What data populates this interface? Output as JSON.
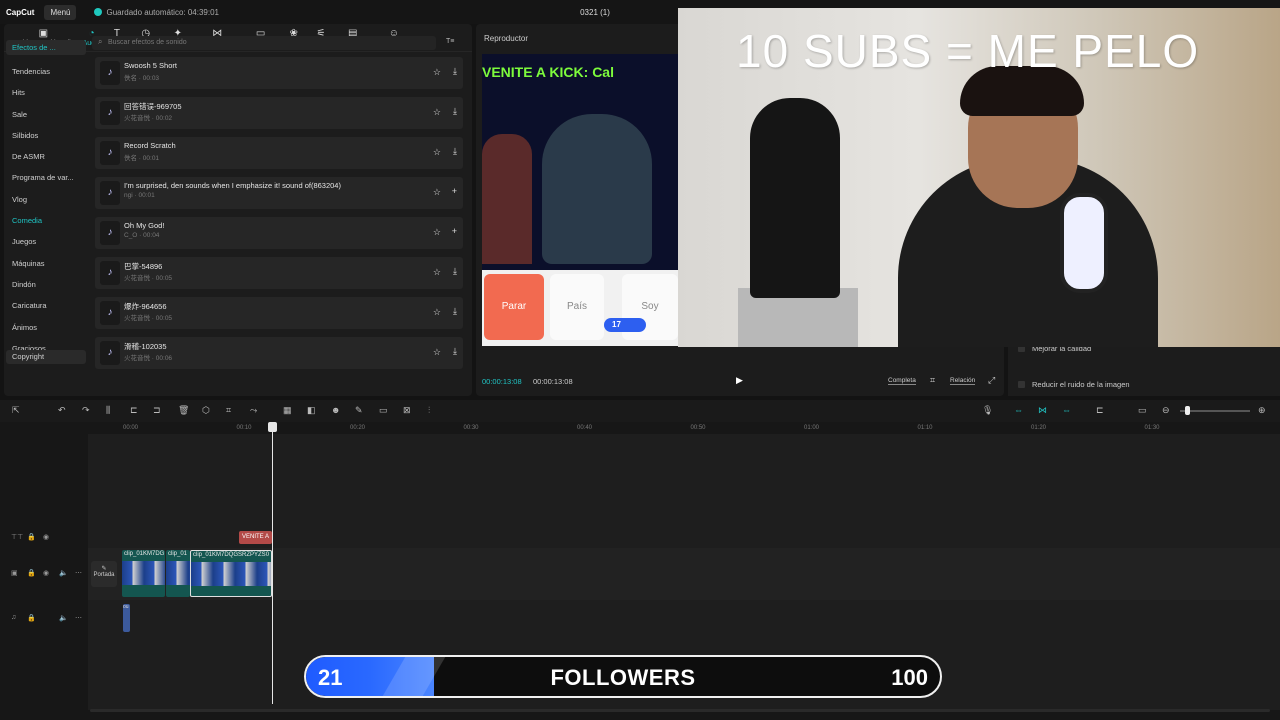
{
  "topbar": {
    "logo": "CapCut",
    "menu": "Menú",
    "autosave": "Guardado automático: 04:39:01",
    "project": "0321 (1)"
  },
  "toolbar": [
    {
      "label": "Archivos multimedia",
      "icon": "media-icon",
      "glyph": "▣"
    },
    {
      "label": "Audio",
      "icon": "audio-icon",
      "glyph": "◔",
      "active": true
    },
    {
      "label": "Texto",
      "icon": "text-icon",
      "glyph": "T"
    },
    {
      "label": "Stickers",
      "icon": "sticker-icon",
      "glyph": "◷"
    },
    {
      "label": "Efectos",
      "icon": "effects-icon",
      "glyph": "✦"
    },
    {
      "label": "Transiciones",
      "icon": "transition-icon",
      "glyph": "⋈"
    },
    {
      "label": "Subtítulos",
      "icon": "captions-icon",
      "glyph": "▭"
    },
    {
      "label": "Filtros",
      "icon": "filter-icon",
      "glyph": "❀"
    },
    {
      "label": "Ajuste",
      "icon": "adjust-icon",
      "glyph": "⚟"
    },
    {
      "label": "Plantillas",
      "icon": "templates-icon",
      "glyph": "▤"
    },
    {
      "label": "Avatar de IA",
      "icon": "avatar-icon",
      "glyph": "☺"
    }
  ],
  "sidebar": {
    "header": "Efectos de ...",
    "items": [
      "Tendencias",
      "Hits",
      "Sale",
      "Silbidos",
      "De ASMR",
      "Programa de var...",
      "Vlog",
      "Comedia",
      "Juegos",
      "Máquinas",
      "Dindón",
      "Caricatura",
      "Ánimos",
      "Graciosos"
    ],
    "highlighted": "Comedia",
    "footer": "Copyright"
  },
  "search": {
    "placeholder": "Buscar efectos de sonido",
    "filter_label": "T≡"
  },
  "sounds": [
    {
      "title": "Swoosh 5 Short",
      "author": "佚名",
      "duration": "00:03",
      "action": "download"
    },
    {
      "title": "回答错误-969705",
      "author": "火花音悦",
      "duration": "00:02",
      "action": "download"
    },
    {
      "title": "Record Scratch",
      "author": "佚名",
      "duration": "00:01",
      "action": "download"
    },
    {
      "title": "I'm surprised, den sounds when I emphasize it! sound of(863204)",
      "author": "ngi",
      "duration": "00:01",
      "action": "add"
    },
    {
      "title": "Oh My God!",
      "author": "C_O",
      "duration": "00:04",
      "action": "add"
    },
    {
      "title": "巴掌-54896",
      "author": "火花音悦",
      "duration": "00:05",
      "action": "download"
    },
    {
      "title": "爆炸-964656",
      "author": "火花音悦",
      "duration": "00:05",
      "action": "download"
    },
    {
      "title": "滑稽-102035",
      "author": "火花音悦",
      "duration": "00:06",
      "action": "download"
    }
  ],
  "player": {
    "title": "Reproductor",
    "banner": "VENITE A KICK: Cal",
    "poll": {
      "stop": "Parar",
      "opt1": "País",
      "opt2": "Soy",
      "count": "17"
    },
    "time_current": "00:00:13:08",
    "time_total": "00:00:13:08",
    "full": "Completa",
    "ratio": "Relación"
  },
  "right_panel": {
    "opt1": "Mejorar la calidad",
    "opt2": "Reducir el ruido de la imagen"
  },
  "overlay": {
    "text": "10 SUBS = ME PELO"
  },
  "timeline": {
    "ticks": [
      "00:00",
      "00:10",
      "00:20",
      "00:30",
      "00:40",
      "00:50",
      "01:00",
      "01:10",
      "01:20",
      "01:30"
    ],
    "text_clip": "VENITE A",
    "clips": [
      "clip_01KM7DG",
      "clip_01",
      "clip_01KM7DQGSRZPYZS0"
    ],
    "cover": "Portada",
    "audio_clip": "ou"
  },
  "followers": {
    "current": "21",
    "label": "FOLLOWERS",
    "goal": "100",
    "progress": 0.21
  },
  "colors": {
    "accent": "#20c4c4",
    "bar": "#2a69ff"
  }
}
